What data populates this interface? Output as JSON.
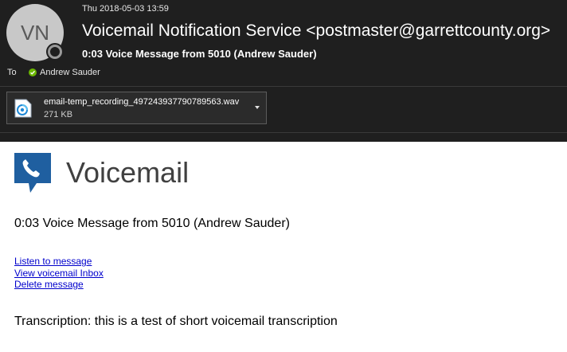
{
  "header": {
    "avatar_initials": "VN",
    "date": "Thu 2018-05-03 13:59",
    "sender": "Voicemail Notification Service <postmaster@garrettcounty.org>",
    "subject": "0:03 Voice Message from 5010 (Andrew Sauder)",
    "to_label": "To",
    "recipient": "Andrew Sauder"
  },
  "attachment": {
    "filename": "email-temp_recording_497243937790789563.wav",
    "size": "271 KB",
    "icon": "audio-file-icon"
  },
  "body": {
    "title": "Voicemail",
    "message": "0:03 Voice Message from 5010 (Andrew Sauder)",
    "links": {
      "listen": "Listen to message",
      "inbox": "View voicemail Inbox",
      "delete": "Delete message"
    },
    "transcription": "Transcription: this is a test of short voicemail transcription"
  },
  "colors": {
    "header_bg": "#1f1f1f",
    "logo_blue": "#1f5fa0",
    "link": "#0000cc",
    "presence_available": "#6bb700"
  }
}
